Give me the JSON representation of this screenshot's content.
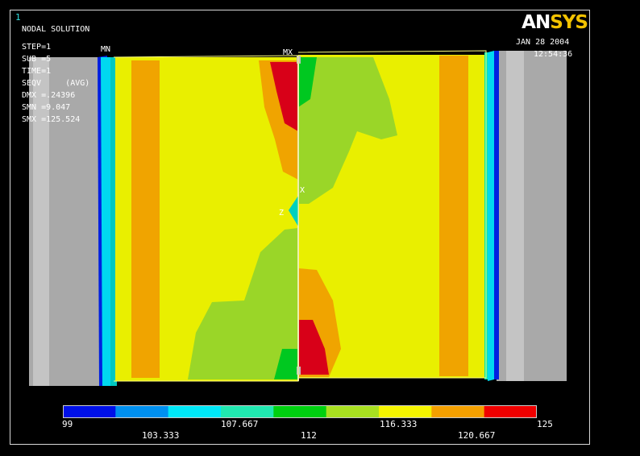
{
  "window_number": "1",
  "logo": {
    "part1": "AN",
    "part2": "SYS"
  },
  "solution_type": "NODAL SOLUTION",
  "info": {
    "step": "STEP=1",
    "sub": "SUB =5",
    "time": "TIME=1",
    "seqv": "SEQV     (AVG)",
    "dmx": "DMX =.24396",
    "smn": "SMN =9.047",
    "smx": "SMX =125.524"
  },
  "date": "JAN 28 2004",
  "time": "12:54:36",
  "markers": {
    "min": "MN",
    "max": "MX",
    "x_axis": "X",
    "z_axis": "Z"
  },
  "colors": {
    "bg": "#000000",
    "grey": "#a8a8a8",
    "yellow": "#e9ef00",
    "green_light": "#9ad628",
    "orange": "#f0a400",
    "red": "#d80018",
    "cyan": "#00e8f0",
    "blue": "#0020e0"
  },
  "legend": {
    "colors": [
      "#0010e8",
      "#0090f0",
      "#00e8f8",
      "#20e8b0",
      "#00d010",
      "#a8e020",
      "#f4f400",
      "#f5a000",
      "#f00000"
    ],
    "labels_top": [
      "99",
      "107.667",
      "116.333",
      "125"
    ],
    "labels_bottom": [
      "103.333",
      "112",
      "120.667"
    ]
  }
}
